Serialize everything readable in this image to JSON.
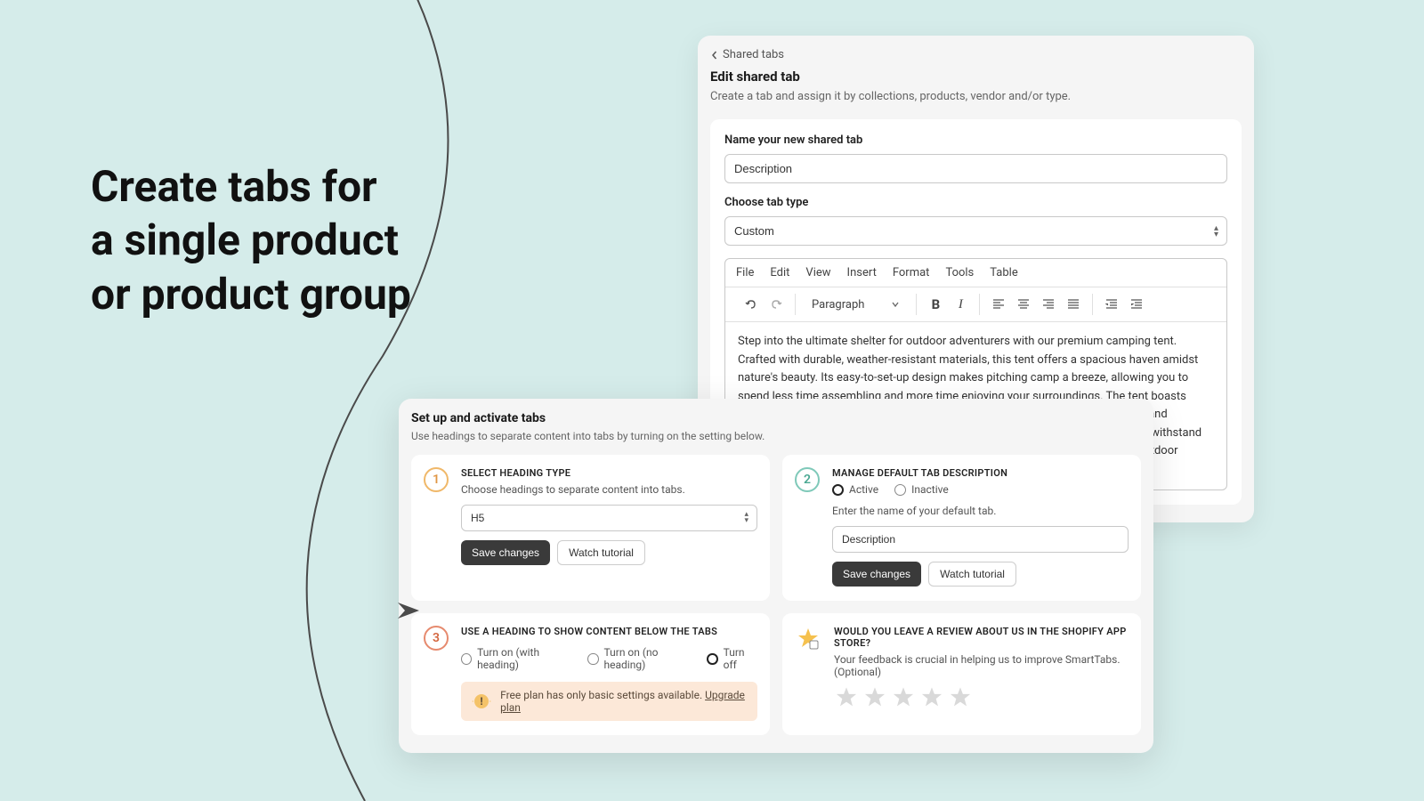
{
  "headline_l1": "Create tabs for",
  "headline_l2": "a single product",
  "headline_l3": "or product group",
  "shared": {
    "back": "Shared tabs",
    "title": "Edit shared tab",
    "subtitle": "Create a tab and assign it by collections, products, vendor and/or type.",
    "name_label": "Name your new shared tab",
    "name_value": "Description",
    "type_label": "Choose tab type",
    "type_value": "Custom",
    "menu": {
      "file": "File",
      "edit": "Edit",
      "view": "View",
      "insert": "Insert",
      "format": "Format",
      "tools": "Tools",
      "table": "Table"
    },
    "para_label": "Paragraph",
    "body": "Step into the ultimate shelter for outdoor adventurers with our premium camping tent. Crafted with durable, weather-resistant materials, this tent offers a spacious haven amidst nature's beauty. Its easy-to-set-up design makes pitching camp a breeze, allowing you to spend less time assembling and more time enjoying your surroundings. The tent boasts ample room for sleeping bags, gear, and even standing space, ensuring comfort and convenience. With excellent ventilation to keep things fresh and a sturdy build to withstand various elements, our camping tent is your reliable companion for memorable outdoor experiences."
  },
  "setup": {
    "title": "Set up and activate tabs",
    "subtitle": "Use headings to separate content into tabs by turning on the setting below.",
    "step1": {
      "num": "1",
      "heading": "SELECT HEADING TYPE",
      "desc": "Choose headings to separate content into tabs.",
      "value": "H5",
      "save": "Save changes",
      "watch": "Watch tutorial"
    },
    "step2": {
      "num": "2",
      "heading": "MANAGE DEFAULT TAB DESCRIPTION",
      "active": "Active",
      "inactive": "Inactive",
      "enter": "Enter the name of your default tab.",
      "value": "Description",
      "save": "Save changes",
      "watch": "Watch tutorial"
    },
    "step3": {
      "num": "3",
      "heading": "USE A HEADING TO SHOW CONTENT BELOW THE TABS",
      "r1": "Turn on (with heading)",
      "r2": "Turn on (no heading)",
      "r3": "Turn off",
      "notice": "Free plan has only basic settings available. ",
      "upgrade": "Upgrade plan"
    },
    "review": {
      "heading": "WOULD YOU LEAVE A REVIEW ABOUT US IN THE SHOPIFY APP STORE?",
      "desc": "Your feedback is crucial in helping us to improve SmartTabs. (Optional)"
    }
  }
}
